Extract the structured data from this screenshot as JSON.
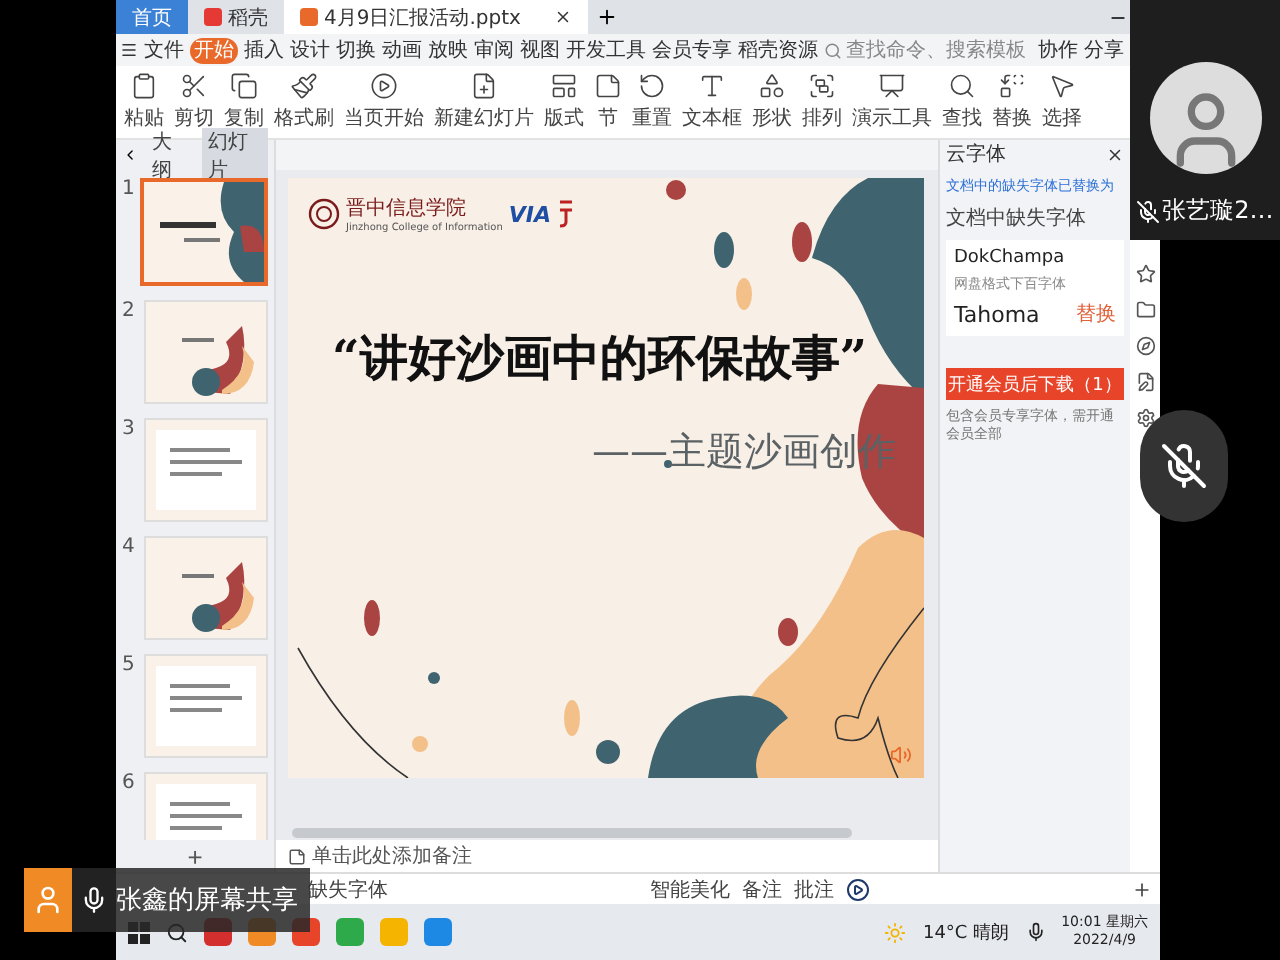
{
  "title_bar": {
    "tabs": [
      {
        "label": "首页",
        "kind": "home",
        "selected": false
      },
      {
        "label": "稻壳",
        "kind": "docer",
        "selected": false
      },
      {
        "label": "4月9日汇报活动.pptx",
        "kind": "file",
        "selected": true
      }
    ]
  },
  "menu": {
    "file": "文件",
    "tabs": [
      {
        "label": "开始",
        "selected": true
      },
      {
        "label": "插入",
        "selected": false
      },
      {
        "label": "设计",
        "selected": false
      },
      {
        "label": "切换",
        "selected": false
      },
      {
        "label": "动画",
        "selected": false
      },
      {
        "label": "放映",
        "selected": false
      },
      {
        "label": "审阅",
        "selected": false
      },
      {
        "label": "视图",
        "selected": false
      },
      {
        "label": "开发工具",
        "selected": false
      },
      {
        "label": "会员专享",
        "selected": false
      },
      {
        "label": "稻壳资源",
        "selected": false
      }
    ],
    "search": {
      "placeholder": "查找命令、搜索模板"
    },
    "actions": [
      "协作",
      "分享"
    ]
  },
  "toolbar": [
    {
      "label": "粘贴",
      "kind": "paste"
    },
    {
      "label": "剪切",
      "kind": "cut"
    },
    {
      "label": "复制",
      "kind": "copy"
    },
    {
      "label": "格式刷",
      "kind": "brush"
    },
    {
      "label": "当页开始",
      "kind": "play"
    },
    {
      "label": "新建幻灯片",
      "kind": "new"
    },
    {
      "label": "版式",
      "kind": "layout"
    },
    {
      "label": "节",
      "kind": "section"
    },
    {
      "label": "重置",
      "kind": "reset"
    },
    {
      "label": "文本框",
      "kind": "text"
    },
    {
      "label": "形状",
      "kind": "shape"
    },
    {
      "label": "排列",
      "kind": "arrange"
    },
    {
      "label": "演示工具",
      "kind": "present"
    },
    {
      "label": "查找",
      "kind": "find"
    },
    {
      "label": "替换",
      "kind": "replace"
    },
    {
      "label": "选择",
      "kind": "select"
    }
  ],
  "left_panel": {
    "tabs": [
      {
        "label": "大纲",
        "selected": false
      },
      {
        "label": "幻灯片",
        "selected": true
      }
    ],
    "slides": [
      {
        "number": "1",
        "kind": "title",
        "selected": true
      },
      {
        "number": "2",
        "kind": "section",
        "selected": false
      },
      {
        "number": "3",
        "kind": "text",
        "selected": false
      },
      {
        "number": "4",
        "kind": "section",
        "selected": false
      },
      {
        "number": "5",
        "kind": "text",
        "selected": false
      },
      {
        "number": "6",
        "kind": "text",
        "selected": false
      }
    ],
    "add": "+"
  },
  "slide": {
    "logo_cn": "晋中信息学院",
    "logo_en": "Jinzhong College of Information",
    "logo_mark": "VIA",
    "title": "“讲好沙画中的环保故事”",
    "subtitle": "——主题沙画创作"
  },
  "notes": {
    "placeholder": "单击此处添加备注"
  },
  "font_panel": {
    "title": "云字体",
    "link": "文档中的缺失字体已替换为",
    "section": "文档中缺失字体",
    "missing_font": "DokChampa",
    "replacement_note": "网盘格式下百字体",
    "replacement_font": "Tahoma",
    "replace": "替换",
    "download_button": "开通会员后下载（1）",
    "warning": "包含会员专享字体，需开通会员全部"
  },
  "status_bar": {
    "missing_fonts": "缺失字体",
    "items": [
      "智能美化",
      "备注",
      "批注"
    ]
  },
  "taskbar": {
    "weather": "14°C 晴朗",
    "time": "10:01 星期六",
    "date": "2022/4/9"
  },
  "meeting": {
    "participant": {
      "name": "张艺璇2…",
      "muted": true
    },
    "mic": {
      "muted": true
    },
    "screen_share": "张鑫的屏幕共享"
  }
}
